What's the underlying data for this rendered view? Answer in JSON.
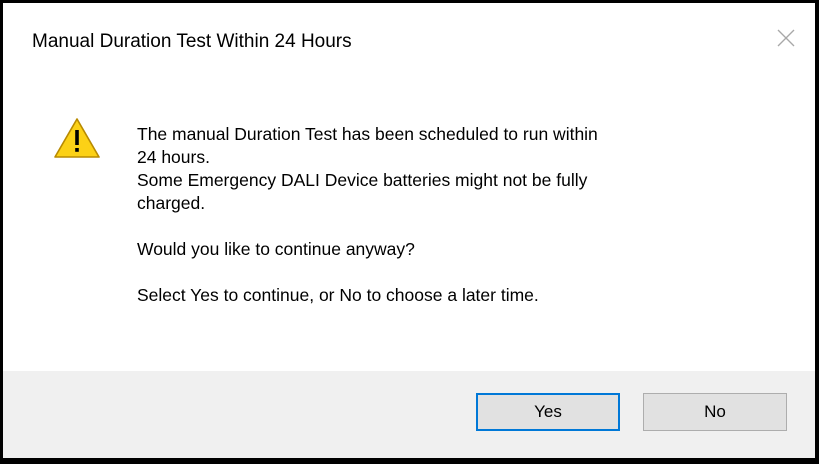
{
  "dialog": {
    "title": "Manual Duration Test Within 24 Hours",
    "icon": "warning-icon",
    "message_lines": [
      "The manual Duration Test has been scheduled to run within",
      "24 hours.",
      "Some Emergency DALI Device batteries might not be fully",
      "charged."
    ],
    "question": "Would you like to continue anyway?",
    "instruction": "Select Yes to continue, or No to choose a later time.",
    "buttons": {
      "yes_label": "Yes",
      "no_label": "No"
    }
  },
  "colors": {
    "accent": "#0078d7",
    "warning_fill": "#fcd116",
    "footer_bg": "#f0f0f0"
  }
}
